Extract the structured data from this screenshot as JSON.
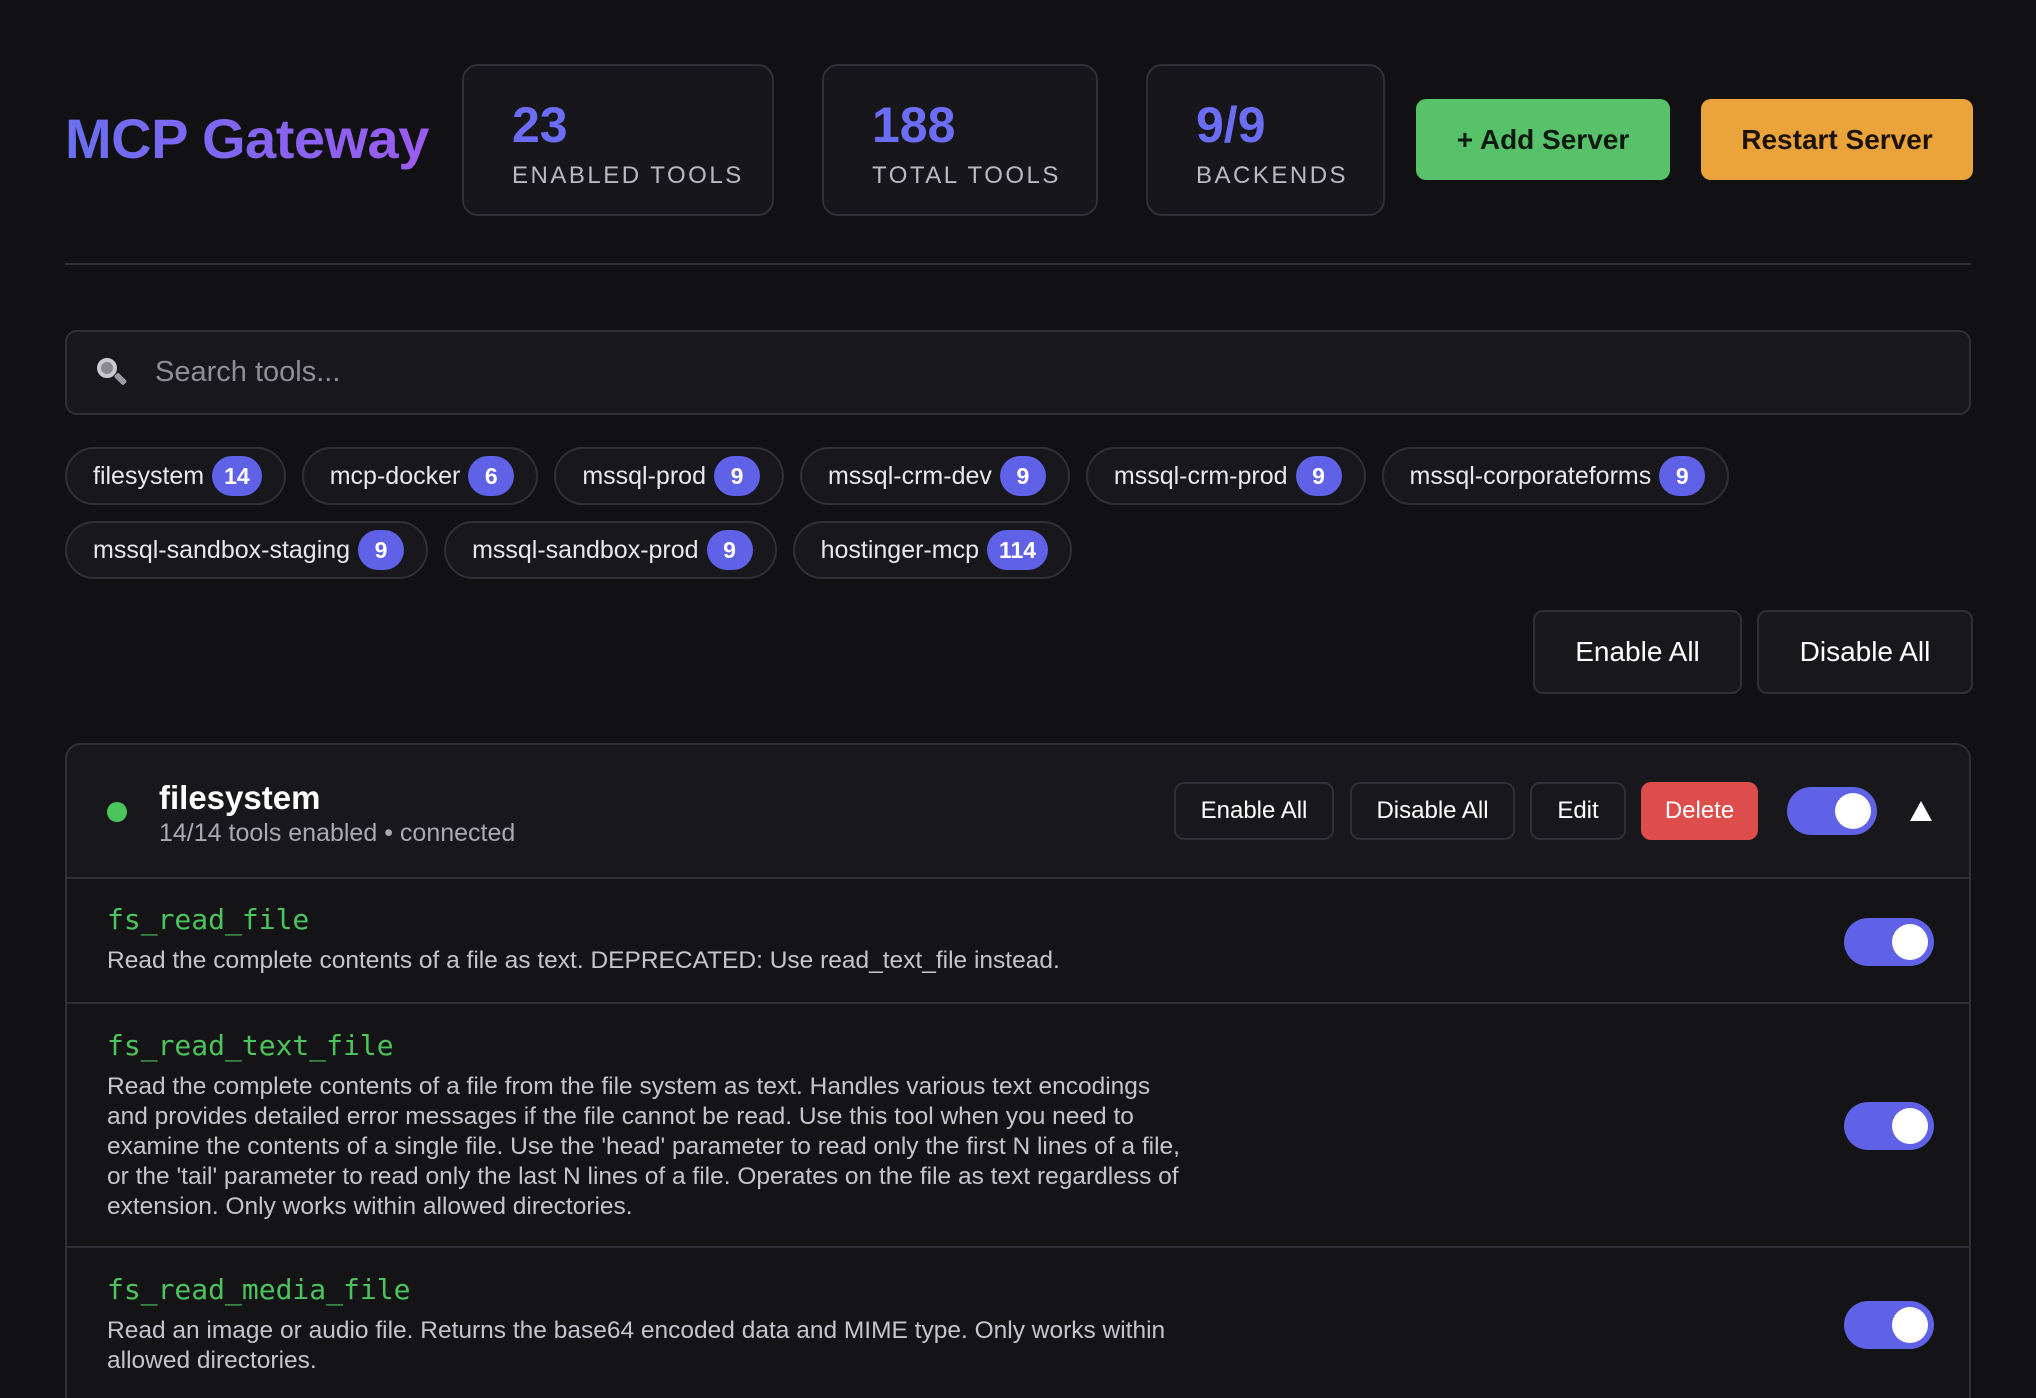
{
  "app": {
    "title": "MCP Gateway"
  },
  "stats": [
    {
      "value": "23",
      "label": "ENABLED TOOLS"
    },
    {
      "value": "188",
      "label": "TOTAL TOOLS"
    },
    {
      "value": "9/9",
      "label": "BACKENDS"
    }
  ],
  "header_actions": {
    "add_server": "+ Add Server",
    "restart_server": "Restart Server"
  },
  "search": {
    "placeholder": "Search tools...",
    "icon": "search-icon",
    "value": ""
  },
  "filters": [
    {
      "name": "filesystem",
      "count": "14"
    },
    {
      "name": "mcp-docker",
      "count": "6"
    },
    {
      "name": "mssql-prod",
      "count": "9"
    },
    {
      "name": "mssql-crm-dev",
      "count": "9"
    },
    {
      "name": "mssql-crm-prod",
      "count": "9"
    },
    {
      "name": "mssql-corporateforms",
      "count": "9"
    },
    {
      "name": "mssql-sandbox-staging",
      "count": "9"
    },
    {
      "name": "mssql-sandbox-prod",
      "count": "9"
    },
    {
      "name": "hostinger-mcp",
      "count": "114"
    }
  ],
  "global_actions": {
    "enable_all": "Enable All",
    "disable_all": "Disable All"
  },
  "server": {
    "name": "filesystem",
    "tools_enabled": "14/14 tools enabled",
    "separator": "•",
    "status": "connected",
    "status_color": "#4cc45c",
    "enabled": true,
    "actions": {
      "enable_all": "Enable All",
      "disable_all": "Disable All",
      "edit": "Edit",
      "delete": "Delete"
    },
    "tools": [
      {
        "name": "fs_read_file",
        "description": "Read the complete contents of a file as text. DEPRECATED: Use read_text_file instead.",
        "enabled": true
      },
      {
        "name": "fs_read_text_file",
        "description_lines": [
          "Read the complete contents of a file from the file system as text. Handles various text encodings",
          "and provides detailed error messages if the file cannot be read. Use this tool when you need to",
          "examine the contents of a single file. Use the 'head' parameter to read only the first N lines of a file,",
          "or the 'tail' parameter to read only the last N lines of a file. Operates on the file as text regardless of",
          "extension. Only works within allowed directories."
        ],
        "enabled": true
      },
      {
        "name": "fs_read_media_file",
        "description_lines": [
          "Read an image or audio file. Returns the base64 encoded data and MIME type. Only works within",
          "allowed directories."
        ],
        "enabled": true
      }
    ]
  },
  "colors": {
    "accent": "#5f62e6",
    "success": "#58c26a",
    "warning": "#eba43c",
    "danger": "#dd4d4b",
    "background": "#111113"
  }
}
